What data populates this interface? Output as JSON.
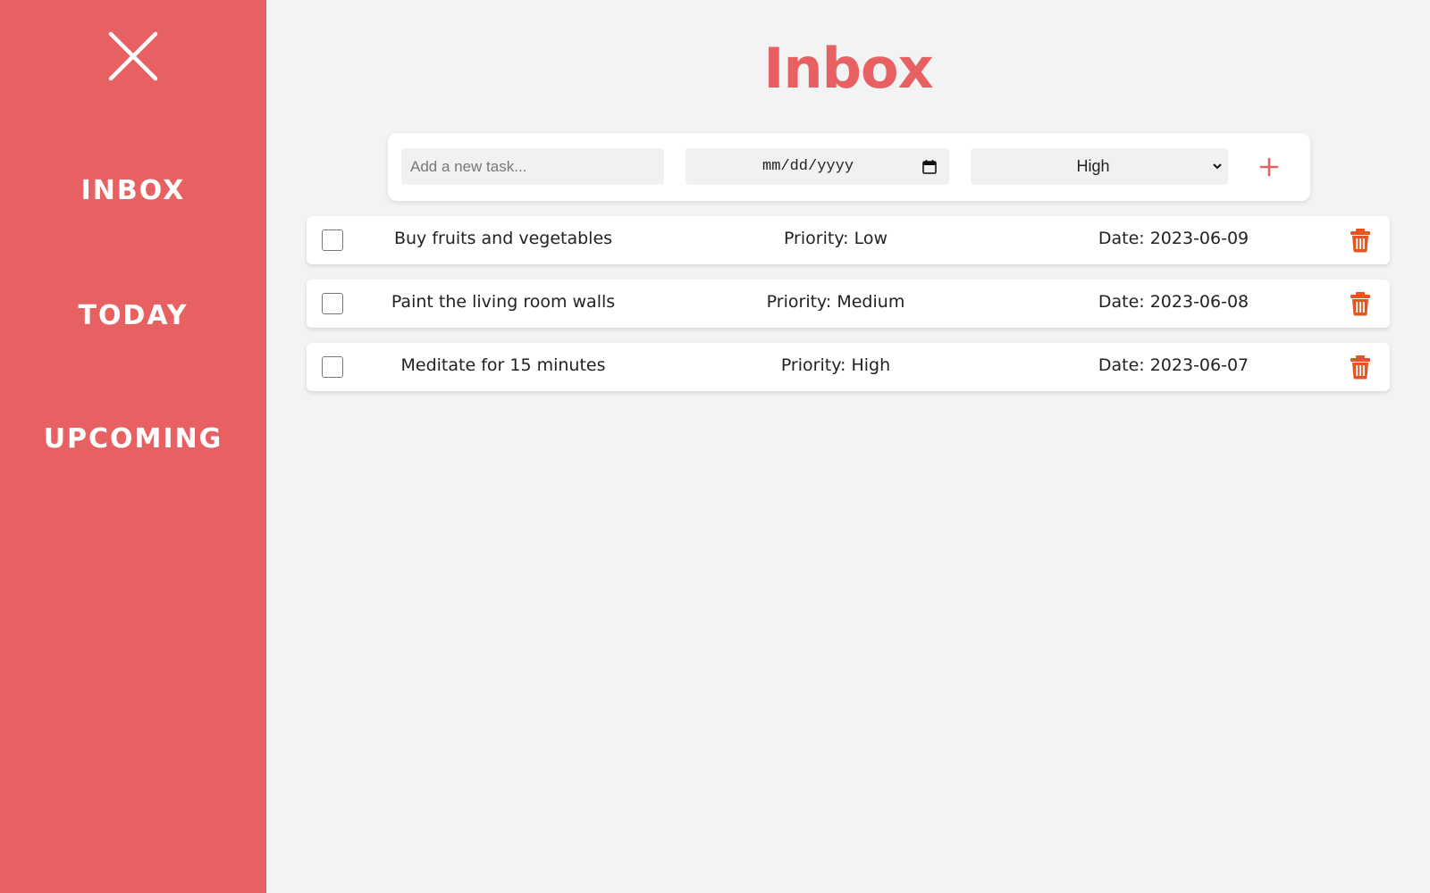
{
  "sidebar": {
    "close_icon": "close-icon",
    "items": [
      {
        "label": "INBOX"
      },
      {
        "label": "TODAY"
      },
      {
        "label": "UPCOMING"
      }
    ]
  },
  "page": {
    "title": "Inbox"
  },
  "new_task": {
    "placeholder": "Add a new task...",
    "date_placeholder": "mm/dd/yyyy",
    "priority_selected": "High",
    "add_icon": "plus-icon"
  },
  "tasks": [
    {
      "name": "Buy fruits and vegetables",
      "priority": "Priority: Low",
      "date": "Date: 2023-06-09"
    },
    {
      "name": "Paint the living room walls",
      "priority": "Priority: Medium",
      "date": "Date: 2023-06-08"
    },
    {
      "name": "Meditate for 15 minutes",
      "priority": "Priority: High",
      "date": "Date: 2023-06-07"
    }
  ],
  "colors": {
    "accent": "#e86162",
    "trash": "#e6541f",
    "background": "#f3f3f3"
  }
}
